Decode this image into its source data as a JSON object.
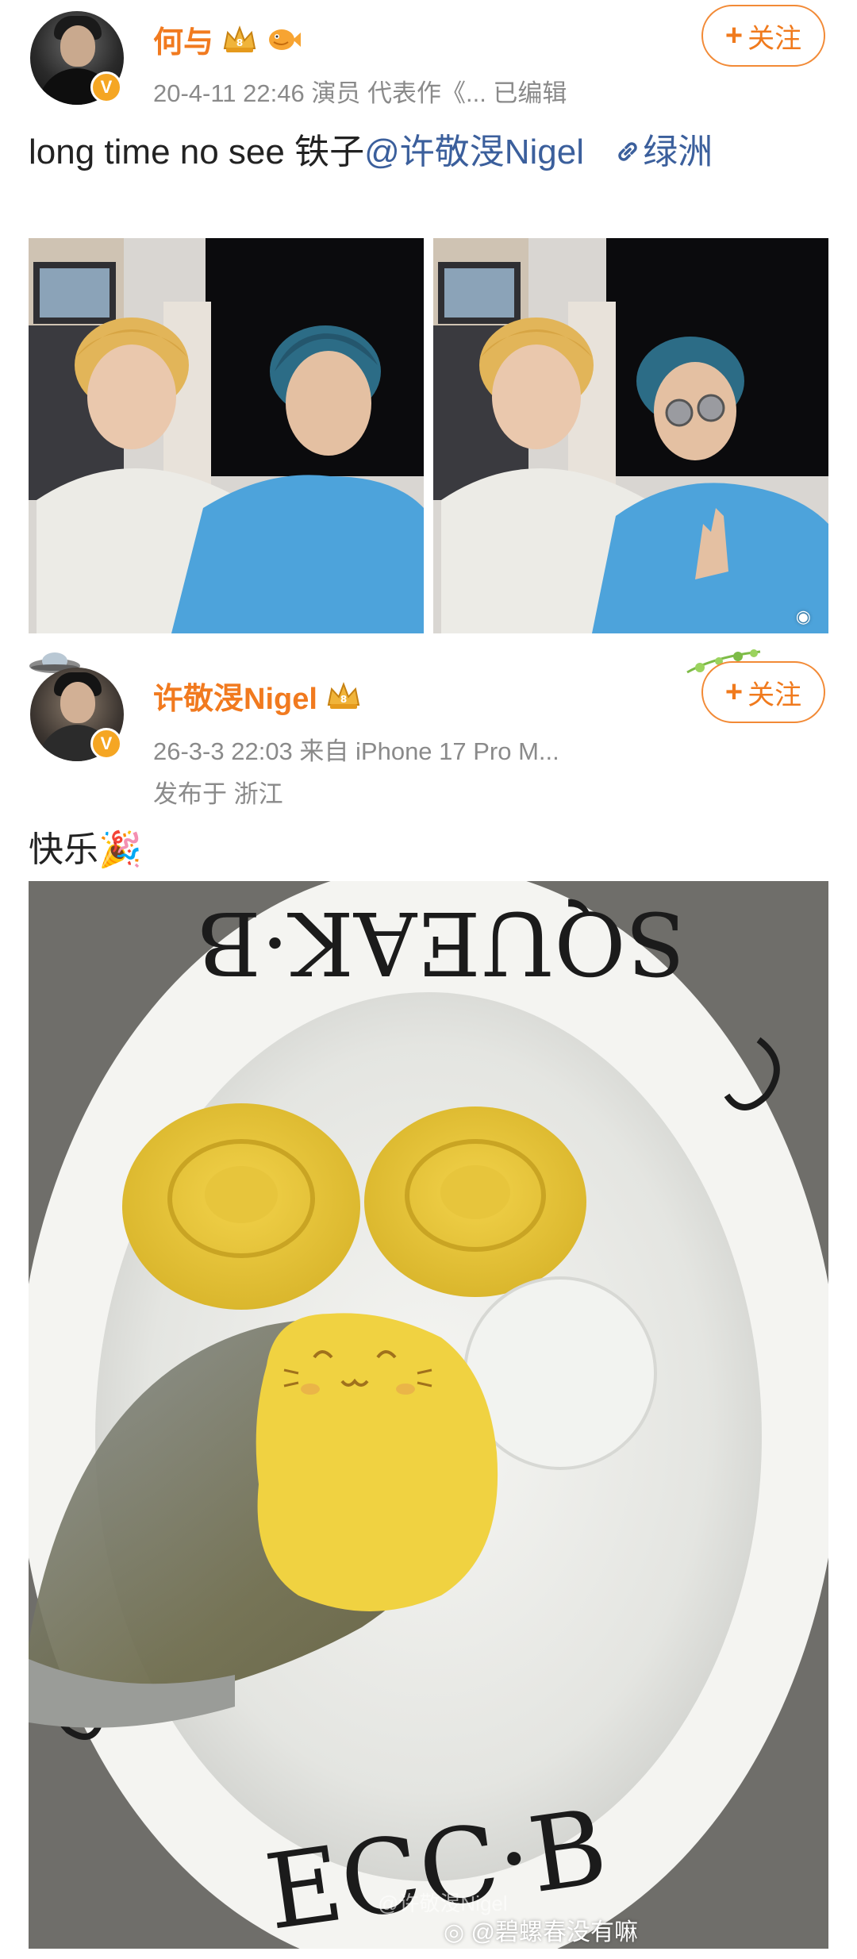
{
  "post1": {
    "username": "何与",
    "meta": "20-4-11 22:46  演员 代表作《...  已编辑",
    "follow_label": "关注",
    "text_before": "long time no see 铁子",
    "mention": "@许敬渂Nigel",
    "link_label": "绿洲",
    "link_icon": "link-icon",
    "colors": {
      "name": "#f17a1f",
      "mention": "#3b5f9c"
    }
  },
  "post2": {
    "username": "许敬渂Nigel",
    "meta_line1": "26-3-3 22:03  来自 iPhone 17 Pro M...",
    "meta_line2": "发布于  浙江",
    "follow_label": "关注",
    "text": "快乐",
    "emoji": "🎉",
    "bowl_rim_top": "SQUEAK·B",
    "bowl_rim_bottom": "ECC·B",
    "image_watermark": "@碧螺春没有嘛",
    "faint_watermark": "@许敬渂Nigel"
  }
}
